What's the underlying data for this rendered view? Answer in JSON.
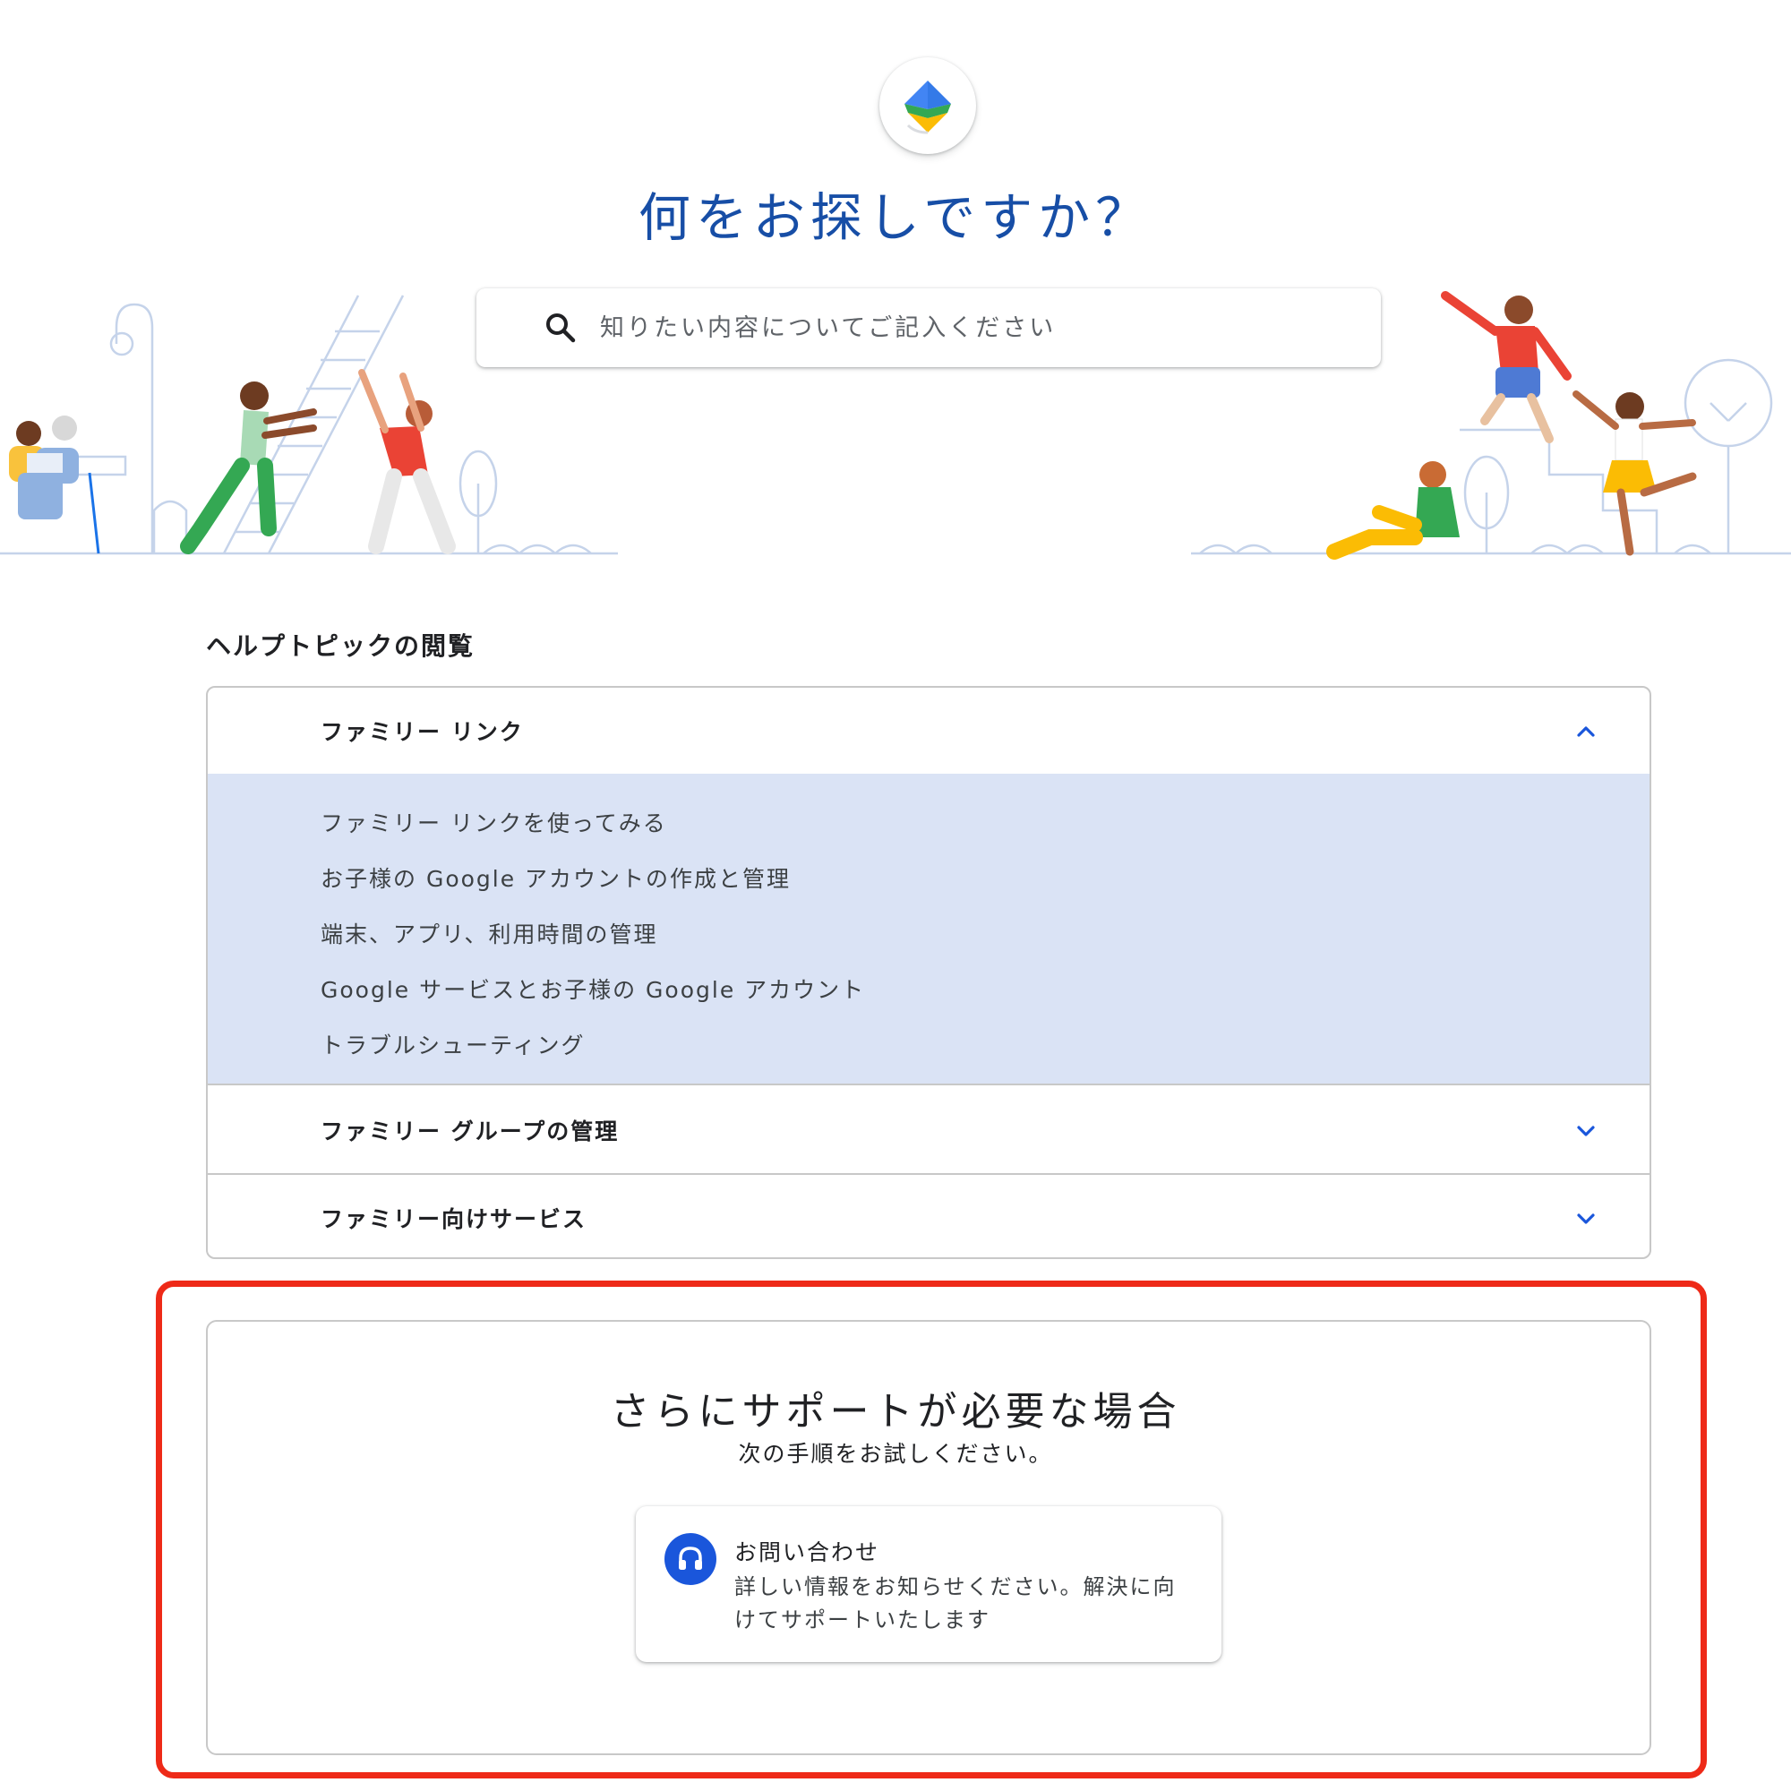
{
  "header": {
    "logo_icon": "google-family-link-logo-icon",
    "title": "何をお探しですか？"
  },
  "search": {
    "icon": "search-icon",
    "placeholder": "知りたい内容についてご記入ください"
  },
  "help_topics": {
    "heading": "ヘルプトピックの閲覧",
    "sections": [
      {
        "title": "ファミリー リンク",
        "expanded": true,
        "icon": "chevron-up-icon",
        "links": [
          "ファミリー リンクを使ってみる",
          "お子様の Google アカウントの作成と管理",
          "端末、アプリ、利用時間の管理",
          "Google サービスとお子様の Google アカウント",
          "トラブルシューティング"
        ]
      },
      {
        "title": "ファミリー グループの管理",
        "expanded": false,
        "icon": "chevron-down-icon"
      },
      {
        "title": "ファミリー向けサービス",
        "expanded": false,
        "icon": "chevron-down-icon"
      }
    ]
  },
  "support": {
    "title": "さらにサポートが必要な場合",
    "subtitle": "次の手順をお試しください。",
    "contact": {
      "icon": "headset-icon",
      "title": "お問い合わせ",
      "description": "詳しい情報をお知らせください。解決に向けてサポートいたします"
    },
    "highlight_color": "#ee2a18"
  },
  "colors": {
    "title_blue": "#174ea6",
    "accent_blue": "#1a56db",
    "panel_bg": "#dae3f5"
  }
}
